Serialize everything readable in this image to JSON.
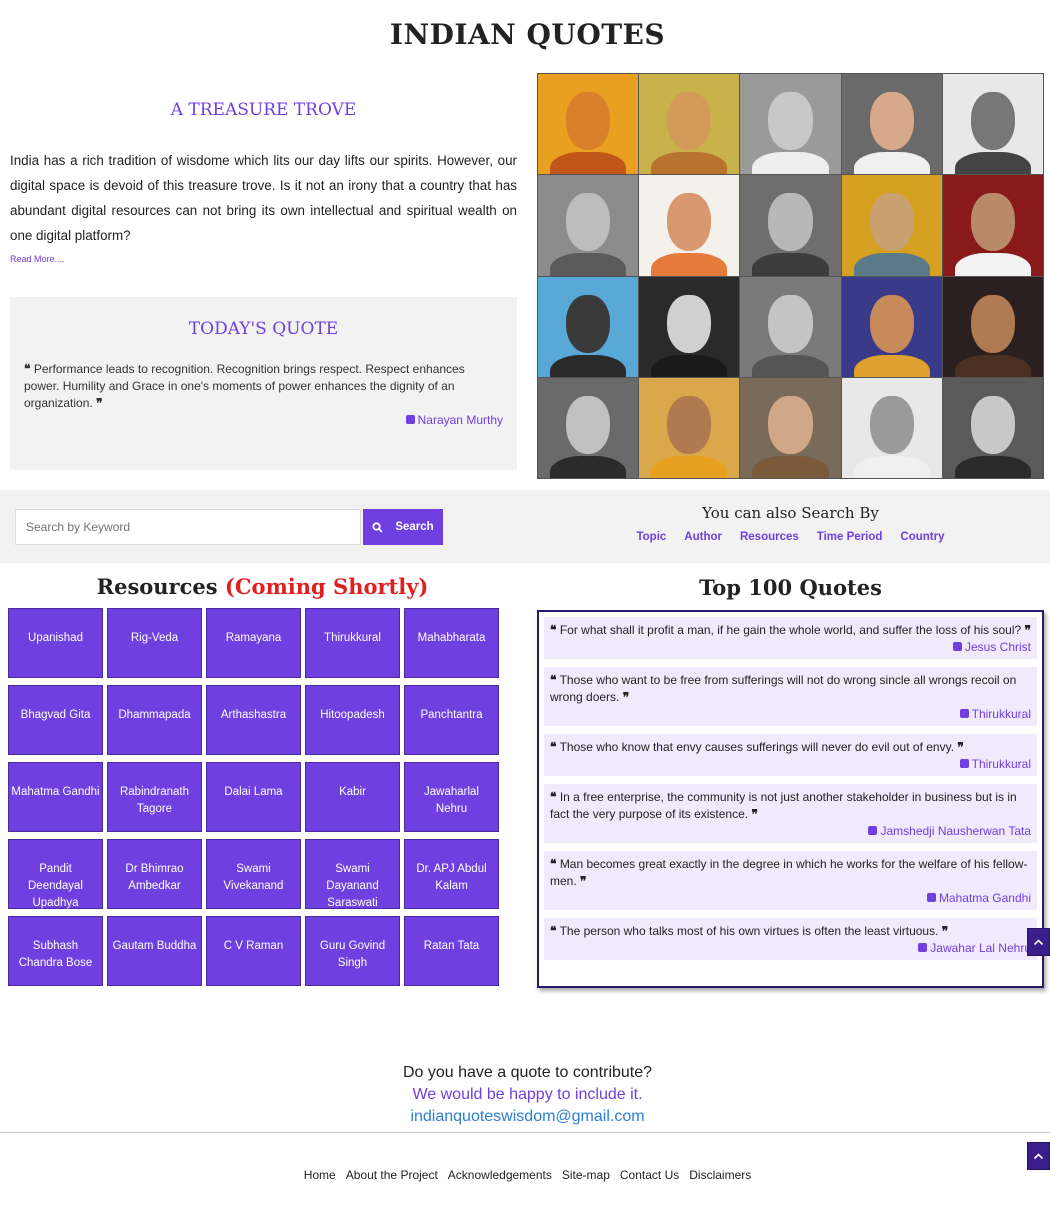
{
  "site": {
    "title": "INDIAN QUOTES"
  },
  "intro": {
    "heading": "A TREASURE TROVE",
    "body": "India has a rich tradition of wisdome which lits our day lifts our spirits. However, our digital space is devoid of this treasure trove. Is it not an irony that a country that has abundant digital resources can not bring its own intellectual and spiritual wealth on one digital platform?",
    "read_more": "Read More...."
  },
  "today": {
    "heading": "TODAY'S QUOTE",
    "quote": "Performance leads to recognition. Recognition brings respect. Respect enhances power. Humility and Grace in one's moments of power enhances the dignity of an organization.",
    "author": "Narayan Murthy"
  },
  "mosaic": {
    "tiles": [
      {
        "bg": "#e9a020",
        "face": "#d97f2a",
        "body": "#c0561a"
      },
      {
        "bg": "#c9b24a",
        "face": "#d49a5a",
        "body": "#b8742f"
      },
      {
        "bg": "#9a9a9a",
        "face": "#c8c8c8",
        "body": "#eeeeee"
      },
      {
        "bg": "#6a6a6a",
        "face": "#d8a88a",
        "body": "#f0f0f0"
      },
      {
        "bg": "#e8e8e8",
        "face": "#777777",
        "body": "#444444"
      },
      {
        "bg": "#8c8c8c",
        "face": "#bdbdbd",
        "body": "#5a5a5a"
      },
      {
        "bg": "#f4f0ea",
        "face": "#d99870",
        "body": "#e57a3a"
      },
      {
        "bg": "#6e6e6e",
        "face": "#b8b8b8",
        "body": "#3c3c3c"
      },
      {
        "bg": "#d6a020",
        "face": "#c9a070",
        "body": "#5a7a8a"
      },
      {
        "bg": "#8a1a1a",
        "face": "#b98a6a",
        "body": "#f2f2f2"
      },
      {
        "bg": "#58a8d8",
        "face": "#3a3a3a",
        "body": "#2a2a2a"
      },
      {
        "bg": "#2a2a2a",
        "face": "#d0d0d0",
        "body": "#1a1a1a"
      },
      {
        "bg": "#7a7a7a",
        "face": "#c4c4c4",
        "body": "#555555"
      },
      {
        "bg": "#3a3a8a",
        "face": "#c88a5a",
        "body": "#e0a030"
      },
      {
        "bg": "#2a2020",
        "face": "#b07a52",
        "body": "#4a3020"
      },
      {
        "bg": "#6a6a6a",
        "face": "#c0c0c0",
        "body": "#2c2c2c"
      },
      {
        "bg": "#d9a84a",
        "face": "#b07a50",
        "body": "#e8a020"
      },
      {
        "bg": "#7a6a5a",
        "face": "#d0a888",
        "body": "#7a5a3a"
      },
      {
        "bg": "#e8e8e8",
        "face": "#9a9a9a",
        "body": "#f0f0f0"
      },
      {
        "bg": "#5a5a5a",
        "face": "#c8c8c8",
        "body": "#2a2a2a"
      }
    ]
  },
  "search": {
    "placeholder": "Search by Keyword",
    "button_label": "Search",
    "also_heading": "You can also Search By",
    "also_links": [
      "Topic",
      "Author",
      "Resources",
      "Time Period",
      "Country"
    ]
  },
  "resources": {
    "title": "Resources",
    "title_note": "(Coming Shortly)",
    "items": [
      "Upanishad",
      "Rig-Veda",
      "Ramayana",
      "Thirukkural",
      "Mahabharata",
      "Bhagvad Gita",
      "Dhammapada",
      "Arthashastra",
      "Hitoopadesh",
      "Panchtantra",
      "Mahatma Gandhi",
      "Rabindranath Tagore",
      "Dalai Lama",
      "Kabir",
      "Jawaharlal Nehru",
      "Pandit Deendayal Upadhya",
      "Dr Bhimrao Ambedkar",
      "Swami Vivekanand",
      "Swami Dayanand Saraswati",
      "Dr. APJ Abdul Kalam",
      "Subhash Chandra Bose",
      "Gautam Buddha",
      "C V Raman",
      "Guru Govind Singh",
      "Ratan Tata"
    ]
  },
  "top_quotes": {
    "title": "Top 100 Quotes",
    "quotes": [
      {
        "text": "For what shall it profit a man, if he gain the whole world, and suffer the loss of his soul?",
        "author": "Jesus Christ"
      },
      {
        "text": "Those who want to be free from sufferings will not do wrong sincle all wrongs recoil on wrong doers.",
        "author": "Thirukkural"
      },
      {
        "text": "Those who know that envy causes sufferings will never do evil out of envy.",
        "author": "Thirukkural"
      },
      {
        "text": "In a free enterprise, the community is not just another stakeholder in business but is in fact the very purpose of its existence.",
        "author": "Jamshedji Nausherwan Tata"
      },
      {
        "text": "Man becomes great exactly in the degree in which he works for the welfare of his fellow-men.",
        "author": "Mahatma Gandhi"
      },
      {
        "text": "The person who talks most of his own virtues is often the least virtuous.",
        "author": "Jawahar Lal Nehru"
      }
    ]
  },
  "contribute": {
    "question": "Do you have a quote to contribute?",
    "happy": "We would be happy to include it.",
    "email": "indianquoteswisdom@gmail.com"
  },
  "footer": {
    "links": [
      "Home",
      "About the Project",
      "Acknowledgements",
      "Site-map",
      "Contact Us",
      "Disclaimers"
    ]
  },
  "colors": {
    "accent": "#6f3fe0",
    "alert": "#e02020",
    "link_blue": "#2a7fd8"
  },
  "icons": {
    "quote_open": "❝",
    "quote_close": "❞",
    "search": "search-icon",
    "scroll_up": "chevron-up-icon",
    "author": "pen-icon"
  }
}
